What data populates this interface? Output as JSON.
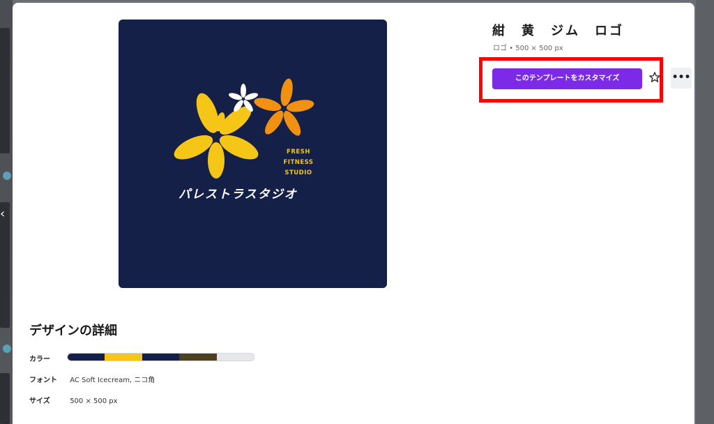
{
  "template": {
    "title": "紺　黄　ジム　ロゴ",
    "meta": "ロゴ • 500 × 500 px",
    "customize_label": "このテンプレートをカスタマイズ",
    "star_icon": "star-outline-icon",
    "more_icon": "more-horizontal-icon",
    "more_glyph": "•••"
  },
  "preview": {
    "background": "#152049",
    "logo_text_en": [
      "FRESH",
      "FITNESS",
      "STUDIO"
    ],
    "logo_text_ja": "パレストラスタジオ",
    "colors": {
      "yellow": "#f5c518",
      "orange": "#f29111",
      "white": "#ffffff"
    }
  },
  "details": {
    "heading": "デザインの詳細",
    "color_label": "カラー",
    "font_label": "フォント",
    "font_value": "AC Soft Icecream, ニコ角",
    "size_label": "サイズ",
    "size_value": "500 × 500 px",
    "palette": [
      "#152049",
      "#f5c518",
      "#152049",
      "#4d4021",
      "#e6e8eb"
    ]
  },
  "nav": {
    "prev_glyph": "‹"
  }
}
